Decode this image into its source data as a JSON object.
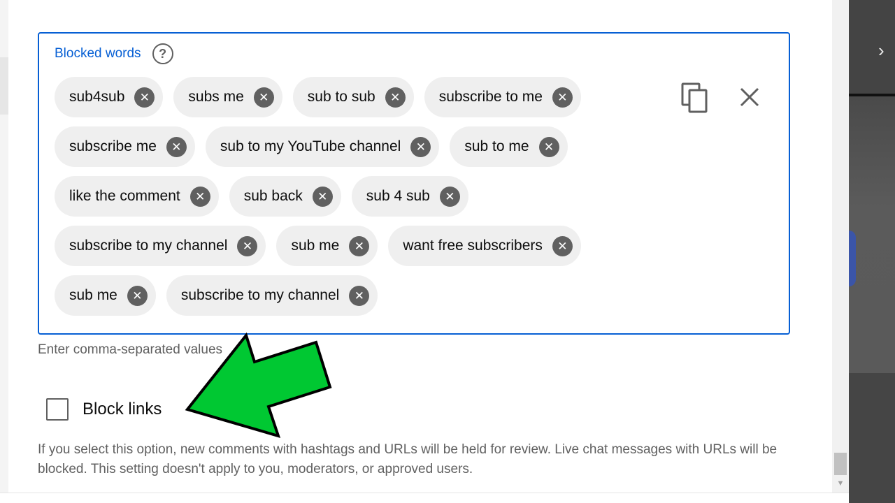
{
  "blocked_words": {
    "label": "Blocked words",
    "help_glyph": "?",
    "remove_glyph": "✕",
    "chip_rows": [
      [
        "sub4sub",
        "subs me",
        "sub to sub",
        "subscribe to me"
      ],
      [
        "subscribe me",
        "sub to my YouTube channel",
        "sub to me"
      ],
      [
        "like the comment",
        "sub back",
        "sub 4 sub"
      ],
      [
        "subscribe to my channel",
        "sub me",
        "want free subscribers"
      ],
      [
        "sub me",
        "subscribe to my channel"
      ]
    ],
    "helper_text": "Enter comma-separated values"
  },
  "block_links": {
    "label": "Block links",
    "checked": false,
    "description": "If you select this option, new comments with hashtags and URLs will be held for review. Live chat messages with URLs will be blocked. This setting doesn't apply to you, moderators, or approved users."
  },
  "icons": {
    "copy": "copy-icon",
    "clear": "close-icon",
    "help": "help-circle-icon",
    "annotation": "green-arrow"
  },
  "colors": {
    "accent": "#065fd4",
    "chip_bg": "#efefef",
    "arrow": "#00c832"
  }
}
